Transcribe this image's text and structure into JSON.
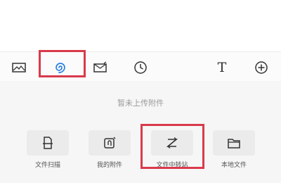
{
  "toolbar": {
    "icons": [
      "image-icon",
      "link-swirl-icon",
      "mail-icon",
      "clock-icon",
      "text-icon",
      "add-circle-icon"
    ],
    "text_icon_glyph": "T",
    "highlight_color": "#d93a4c"
  },
  "panel": {
    "empty_text": "暂未上传附件",
    "options": [
      {
        "label": "文件扫描",
        "icon": "scan-file-icon"
      },
      {
        "label": "我的附件",
        "icon": "attachment-icon"
      },
      {
        "label": "文件中转站",
        "icon": "transfer-icon"
      },
      {
        "label": "本地文件",
        "icon": "folder-icon"
      }
    ]
  }
}
